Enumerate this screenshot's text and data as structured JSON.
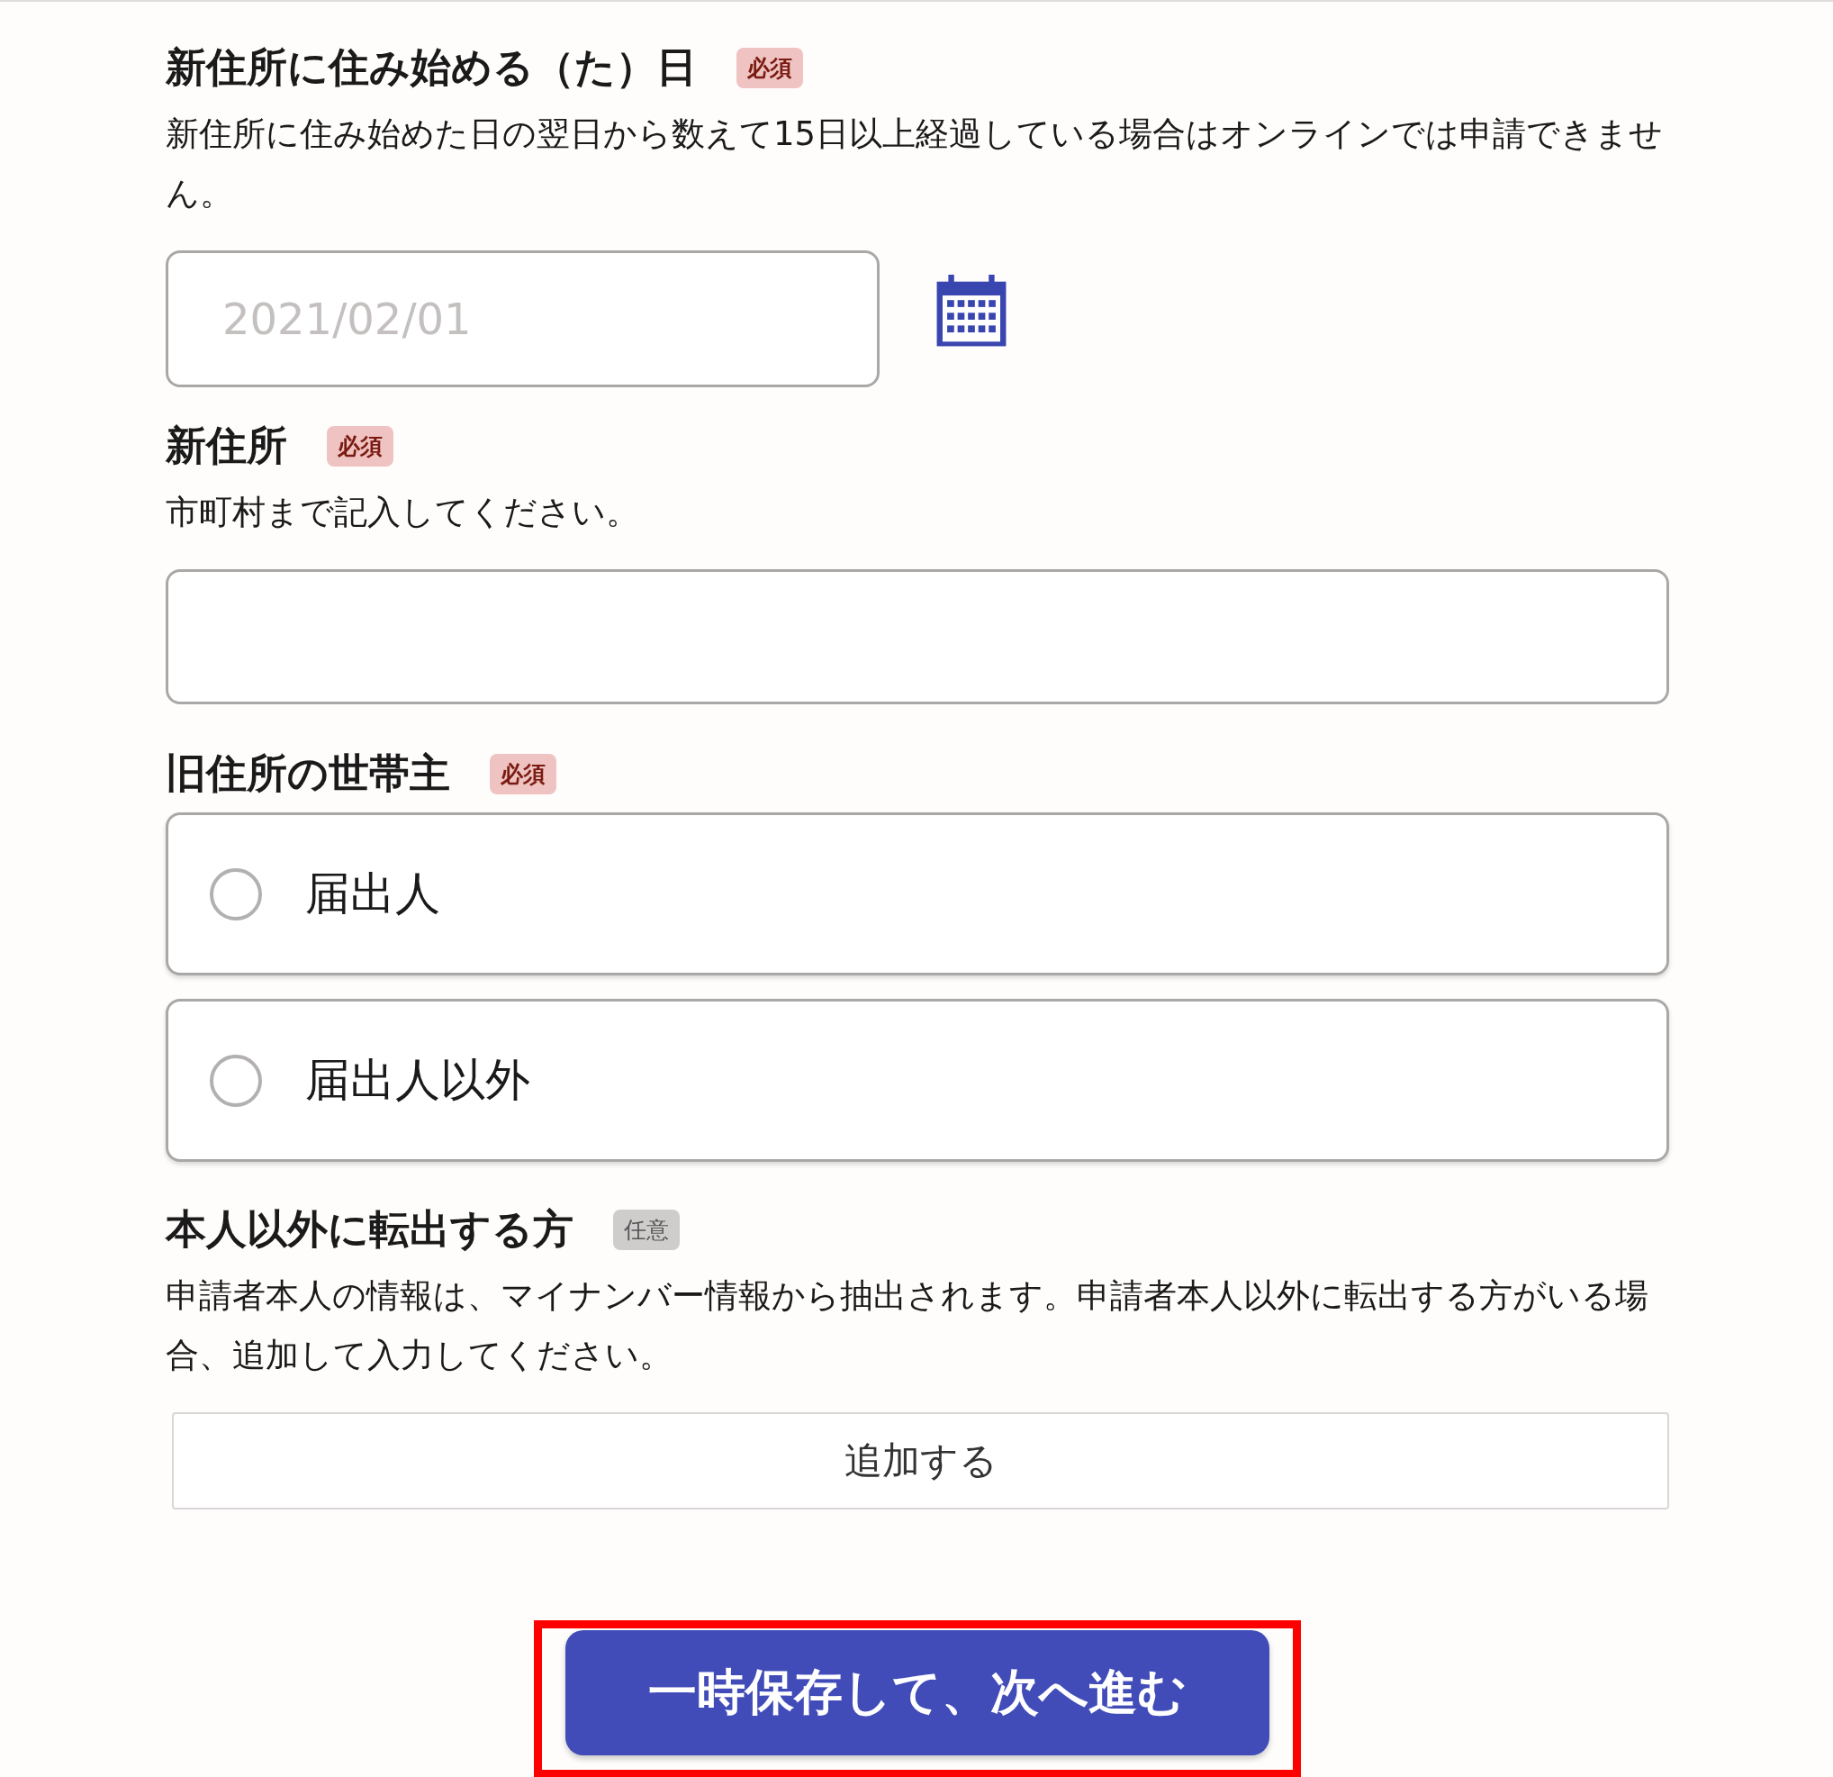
{
  "sections": [
    {
      "kind": "date",
      "heading": "新住所に住み始める（た）日",
      "badge": {
        "kind": "required",
        "label": "必須"
      },
      "description": "新住所に住み始めた日の翌日から数えて15日以上経過している場合はオンラインでは申請できません。",
      "field": {
        "placeholder": "2021/02/01"
      }
    },
    {
      "kind": "text",
      "heading": "新住所",
      "badge": {
        "kind": "required",
        "label": "必須"
      },
      "description": "市町村まで記入してください。"
    },
    {
      "kind": "radio",
      "heading": "旧住所の世帯主",
      "badge": {
        "kind": "required",
        "label": "必須"
      },
      "options": [
        {
          "label": "届出人",
          "selected": false
        },
        {
          "label": "届出人以外",
          "selected": false
        }
      ]
    },
    {
      "kind": "add",
      "heading": "本人以外に転出する方",
      "badge": {
        "kind": "optional",
        "label": "任意"
      },
      "description": "申請者本人の情報は、マイナンバー情報から抽出されます。申請者本人以外に転出する方がいる場合、追加して入力してください。",
      "button": "追加する"
    }
  ],
  "submit": {
    "label": "一時保存して、次へ進む",
    "highlighted": true
  }
}
